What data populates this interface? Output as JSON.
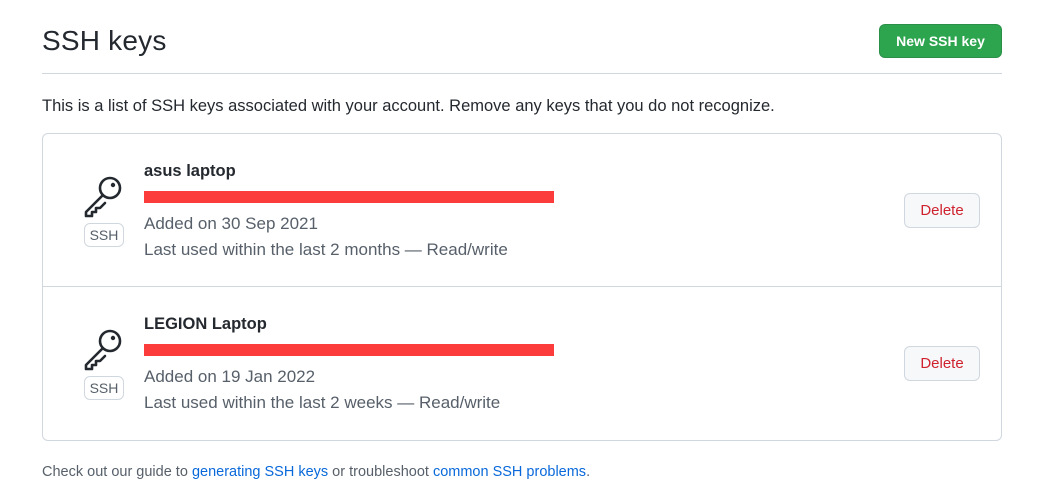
{
  "header": {
    "title": "SSH keys",
    "new_key_label": "New SSH key"
  },
  "intro": "This is a list of SSH keys associated with your account. Remove any keys that you do not recognize.",
  "keys": [
    {
      "title": "asus laptop",
      "badge": "SSH",
      "added": "Added on 30 Sep 2021",
      "last_used": "Last used within the last 2 months — Read/write",
      "delete_label": "Delete"
    },
    {
      "title": "LEGION Laptop",
      "badge": "SSH",
      "added": "Added on 19 Jan 2022",
      "last_used": "Last used within the last 2 weeks — Read/write",
      "delete_label": "Delete"
    }
  ],
  "footer": {
    "prefix": "Check out our guide to ",
    "link1": "generating SSH keys",
    "middle": " or troubleshoot ",
    "link2": "common SSH problems",
    "suffix": "."
  },
  "colors": {
    "primary_button": "#2da44e",
    "danger_text": "#cf222e",
    "link": "#0969da",
    "redaction": "#fc3b3b"
  },
  "icons": [
    "key-icon"
  ]
}
